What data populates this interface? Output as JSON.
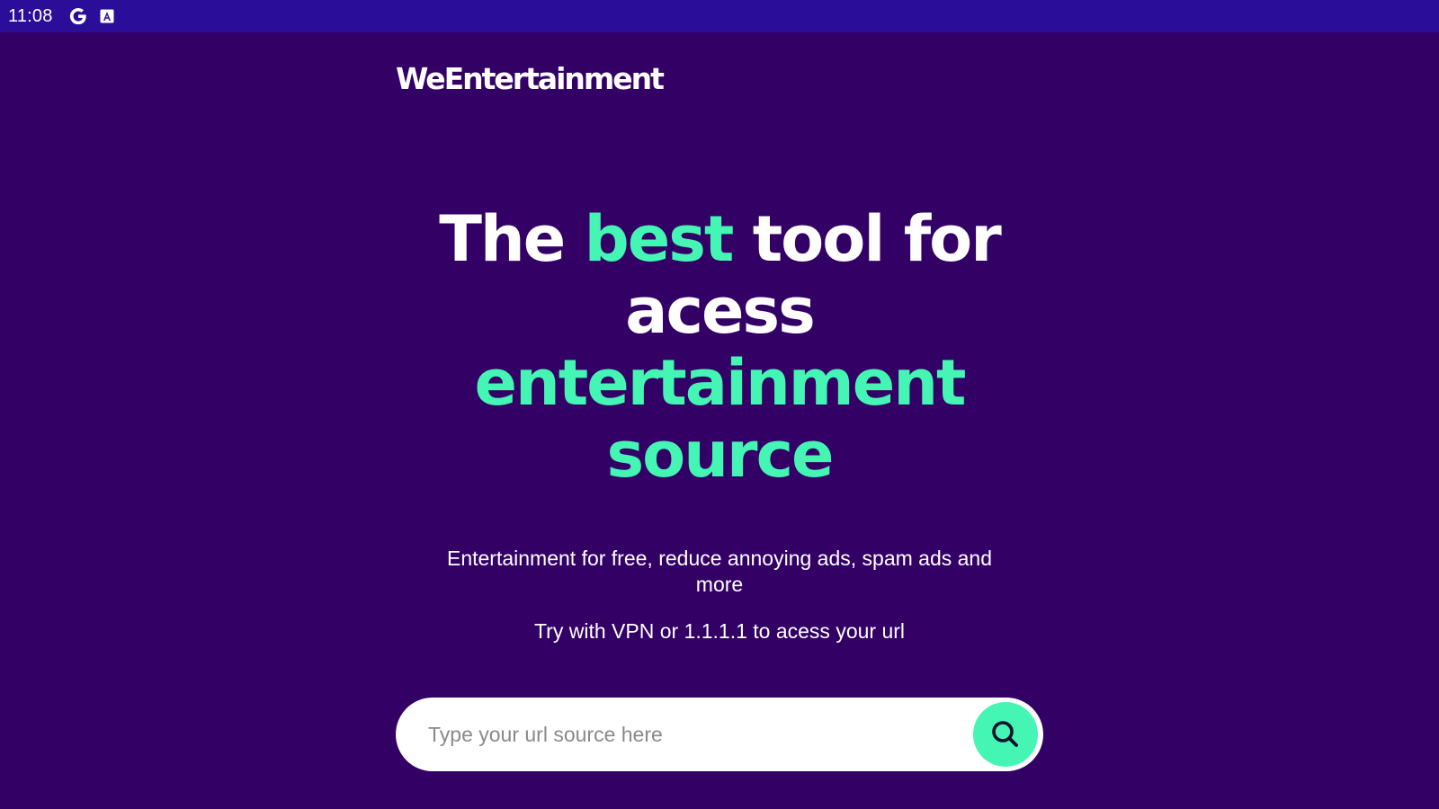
{
  "status_bar": {
    "time": "11:08",
    "icons": [
      "google-g-icon",
      "assistant-a-icon"
    ]
  },
  "brand": {
    "name": "WeEntertainment"
  },
  "hero": {
    "part1": "The ",
    "part2": "best",
    "part3": " tool for acess ",
    "part4": "entertainment source"
  },
  "subtitle": {
    "line1": "Entertainment for free, reduce annoying ads, spam ads and more",
    "line2": "Try with VPN or 1.1.1.1 to acess your url"
  },
  "search": {
    "placeholder": "Type your url source here",
    "value": "",
    "button_icon": "search-icon"
  },
  "colors": {
    "background": "#330066",
    "status_bar": "#2a0d99",
    "accent": "#44f5b4",
    "text": "#ffffff"
  }
}
